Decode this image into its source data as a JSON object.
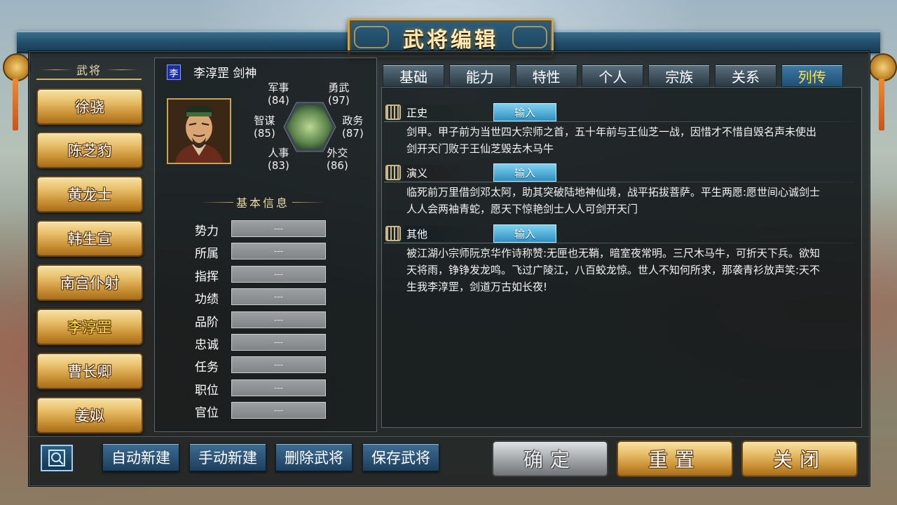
{
  "window": {
    "title": "武将编辑"
  },
  "general_list": {
    "header": "武将",
    "items": [
      {
        "label": "徐骁",
        "selected": false
      },
      {
        "label": "陈芝豹",
        "selected": false
      },
      {
        "label": "黄龙士",
        "selected": false
      },
      {
        "label": "韩生宣",
        "selected": false
      },
      {
        "label": "南宫仆射",
        "selected": false
      },
      {
        "label": "李淳罡",
        "selected": true
      },
      {
        "label": "曹长卿",
        "selected": false
      },
      {
        "label": "姜姒",
        "selected": false
      }
    ]
  },
  "general": {
    "surname_badge": "李",
    "name_line": "李淳罡 剑神",
    "stats": {
      "military": {
        "label": "军事",
        "value": "(84)"
      },
      "valor": {
        "label": "勇武",
        "value": "(97)"
      },
      "strategy": {
        "label": "智谋",
        "value": "(85)"
      },
      "politics": {
        "label": "政务",
        "value": "(87)"
      },
      "personnel": {
        "label": "人事",
        "value": "(83)"
      },
      "diplomacy": {
        "label": "外交",
        "value": "(86)"
      }
    },
    "basic_info_title": "基本信息",
    "fields": [
      {
        "label": "势力",
        "value": "---"
      },
      {
        "label": "所属",
        "value": "---"
      },
      {
        "label": "指挥",
        "value": "---"
      },
      {
        "label": "功绩",
        "value": "---"
      },
      {
        "label": "品阶",
        "value": "---"
      },
      {
        "label": "忠诚",
        "value": "---"
      },
      {
        "label": "任务",
        "value": "---"
      },
      {
        "label": "职位",
        "value": "---"
      },
      {
        "label": "官位",
        "value": "---"
      }
    ]
  },
  "tabs": [
    {
      "label": "基础",
      "active": false
    },
    {
      "label": "能力",
      "active": false
    },
    {
      "label": "特性",
      "active": false
    },
    {
      "label": "个人",
      "active": false
    },
    {
      "label": "宗族",
      "active": false
    },
    {
      "label": "关系",
      "active": false
    },
    {
      "label": "列传",
      "active": true
    }
  ],
  "biography": [
    {
      "category": "正史",
      "color": "#3f7a2c",
      "input_label": "输入",
      "lines": [
        "剑甲。甲子前为当世四大宗师之首，五十年前与王仙芝一战，因惜才不惜自毁名声未使出",
        "剑开天门败于王仙芝毁去木马牛"
      ]
    },
    {
      "category": "演义",
      "color": "#9a2a2a",
      "input_label": "输入",
      "lines": [
        "临死前万里借剑邓太阿，助其突破陆地神仙境，战平拓拔菩萨。平生两愿:愿世间心诚剑士",
        "人人会两袖青蛇，愿天下惊艳剑士人人可剑开天门"
      ]
    },
    {
      "category": "其他",
      "color": "#2a5a86",
      "input_label": "输入",
      "lines": [
        "被江湖小宗师阮京华作诗称赞:无匣也无鞘，暗室夜常明。三尺木马牛，可折天下兵。欲知",
        "天将雨，铮铮发龙鸣。飞过广陵江，八百蛟龙惊。世人不知何所求，那袭青衫放声笑:天不",
        "生我李淳罡，剑道万古如长夜!"
      ]
    }
  ],
  "bottom_bar": {
    "auto_create": "自动新建",
    "manual_create": "手动新建",
    "delete_general": "删除武将",
    "save_general": "保存武将",
    "confirm": "确定",
    "reset": "重置",
    "close": "关闭"
  },
  "colors": {
    "gold_accent": "#c9a553",
    "selected_text": "#ffe34a",
    "panel_bg": "#161c1e"
  }
}
